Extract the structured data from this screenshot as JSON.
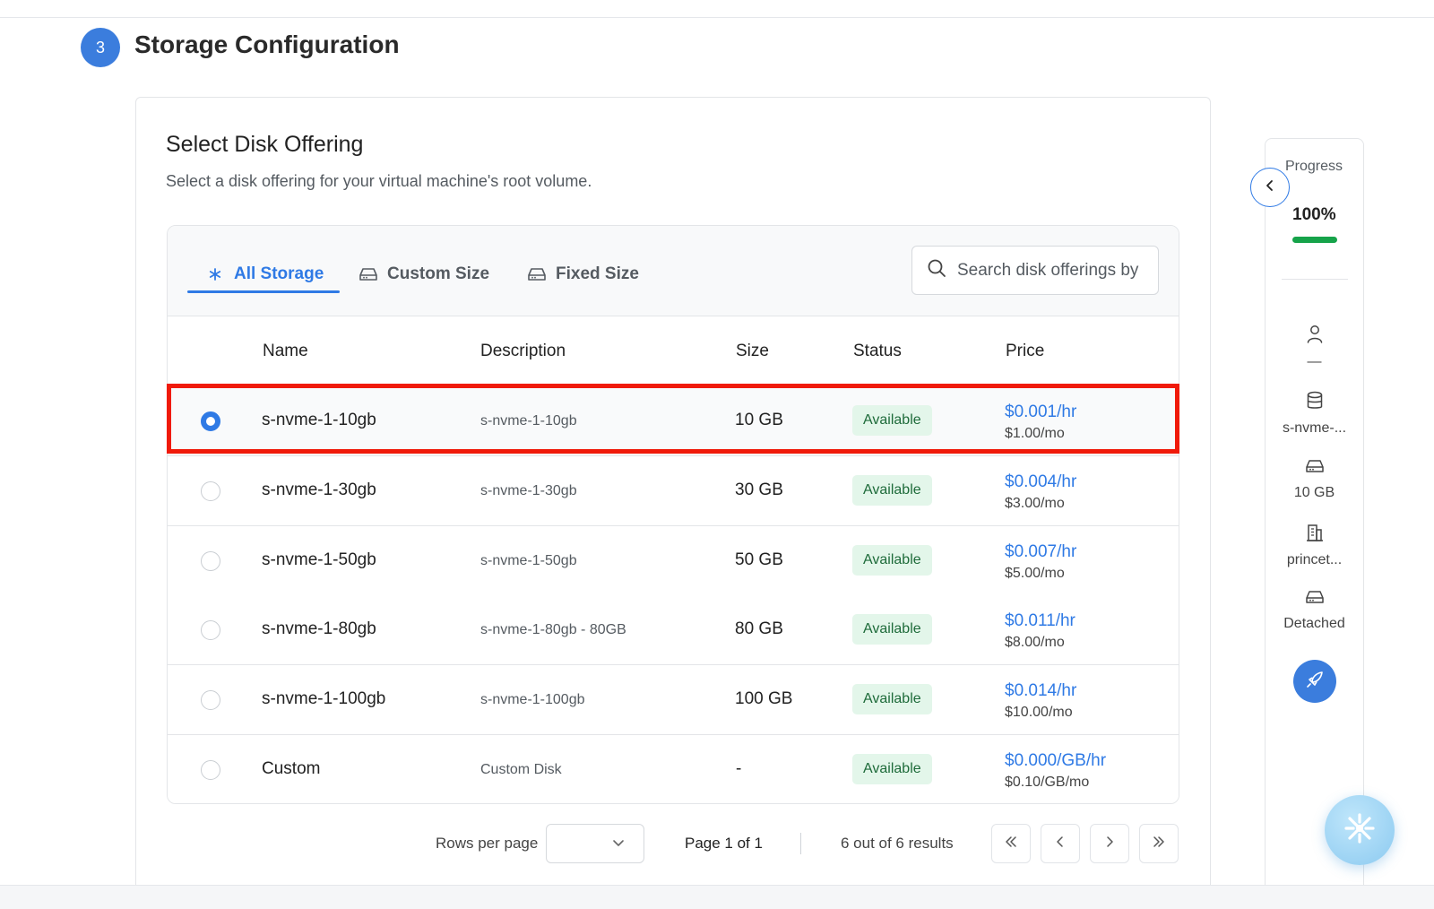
{
  "step": {
    "number": "3",
    "title": "Storage Configuration"
  },
  "card": {
    "title": "Select Disk Offering",
    "subtitle": "Select a disk offering for your virtual machine's root volume."
  },
  "tabs": [
    {
      "label": "All Storage",
      "icon": "asterisk-icon",
      "active": true
    },
    {
      "label": "Custom Size",
      "icon": "hard-drive-icon",
      "active": false
    },
    {
      "label": "Fixed Size",
      "icon": "hard-drive-icon",
      "active": false
    }
  ],
  "search": {
    "placeholder": "Search disk offerings by",
    "value": ""
  },
  "table": {
    "columns": [
      "Name",
      "Description",
      "Size",
      "Status",
      "Price"
    ],
    "rows": [
      {
        "name": "s-nvme-1-10gb",
        "description": "s-nvme-1-10gb",
        "size": "10 GB",
        "status": "Available",
        "price_hr": "$0.001/hr",
        "price_mo": "$1.00/mo",
        "selected": true
      },
      {
        "name": "s-nvme-1-30gb",
        "description": "s-nvme-1-30gb",
        "size": "30 GB",
        "status": "Available",
        "price_hr": "$0.004/hr",
        "price_mo": "$3.00/mo",
        "selected": false
      },
      {
        "name": "s-nvme-1-50gb",
        "description": "s-nvme-1-50gb",
        "size": "50 GB",
        "status": "Available",
        "price_hr": "$0.007/hr",
        "price_mo": "$5.00/mo",
        "selected": false
      },
      {
        "name": "s-nvme-1-80gb",
        "description": "s-nvme-1-80gb - 80GB",
        "size": "80 GB",
        "status": "Available",
        "price_hr": "$0.011/hr",
        "price_mo": "$8.00/mo",
        "selected": false
      },
      {
        "name": "s-nvme-1-100gb",
        "description": "s-nvme-1-100gb",
        "size": "100 GB",
        "status": "Available",
        "price_hr": "$0.014/hr",
        "price_mo": "$10.00/mo",
        "selected": false
      },
      {
        "name": "Custom",
        "description": "Custom Disk",
        "size": "-",
        "status": "Available",
        "price_hr": "$0.000/GB/hr",
        "price_mo": "$0.10/GB/mo",
        "selected": false
      }
    ]
  },
  "pagination": {
    "rows_per_page_label": "Rows per page",
    "rows_per_page_value": "",
    "page_label": "Page 1 of 1",
    "results_label": "6 out of 6 results"
  },
  "sidebar": {
    "progress_label": "Progress",
    "progress_value": "100%",
    "progress_fraction": 1.0,
    "items": [
      {
        "icon": "user-icon",
        "label": "—"
      },
      {
        "icon": "database-icon",
        "label": "s-nvme-..."
      },
      {
        "icon": "hard-drive-icon",
        "label": "10 GB"
      },
      {
        "icon": "building-icon",
        "label": "princet..."
      },
      {
        "icon": "hard-drive-icon",
        "label": "Detached"
      }
    ]
  },
  "colors": {
    "accent": "#2f7ae5",
    "step_circle": "#3b7ddd",
    "status_bg": "#e3f6ea",
    "status_text": "#1e6b3a",
    "progress": "#16a34a",
    "highlight": "#f01a0a"
  }
}
